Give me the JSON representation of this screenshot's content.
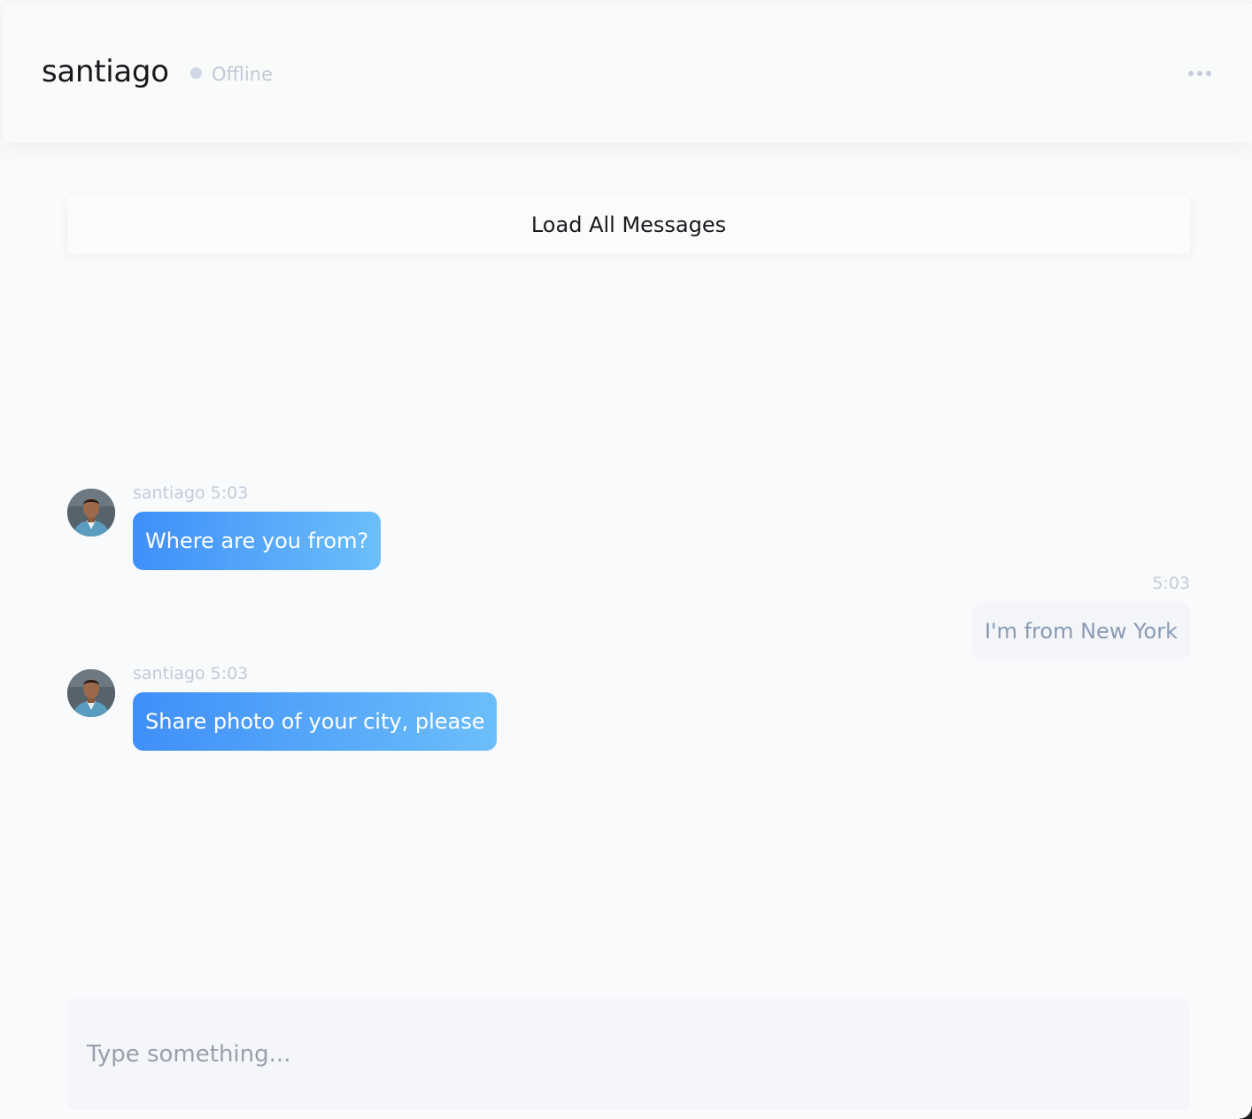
{
  "header": {
    "contact_name": "santiago",
    "status": "Offline",
    "status_color": "#d0d8e8",
    "menu_icon": "more-horizontal-icon"
  },
  "load_all": {
    "label": "Load All Messages"
  },
  "messages": [
    {
      "direction": "incoming",
      "author": "santiago",
      "time": "5:03",
      "meta": "santiago 5:03",
      "text": "Where are you from?",
      "avatar": "avatar-santiago"
    },
    {
      "direction": "outgoing",
      "time": "5:03",
      "meta": "5:03",
      "text": "I'm from New York"
    },
    {
      "direction": "incoming",
      "author": "santiago",
      "time": "5:03",
      "meta": "santiago 5:03",
      "text": "Share photo of your city, please",
      "avatar": "avatar-santiago"
    }
  ],
  "composer": {
    "placeholder": "Type something..."
  },
  "colors": {
    "incoming_gradient_start": "#3f8ff9",
    "incoming_gradient_end": "#6cbefa",
    "outgoing_bubble": "#f3f5f9",
    "outgoing_text": "#8a9ab4"
  }
}
